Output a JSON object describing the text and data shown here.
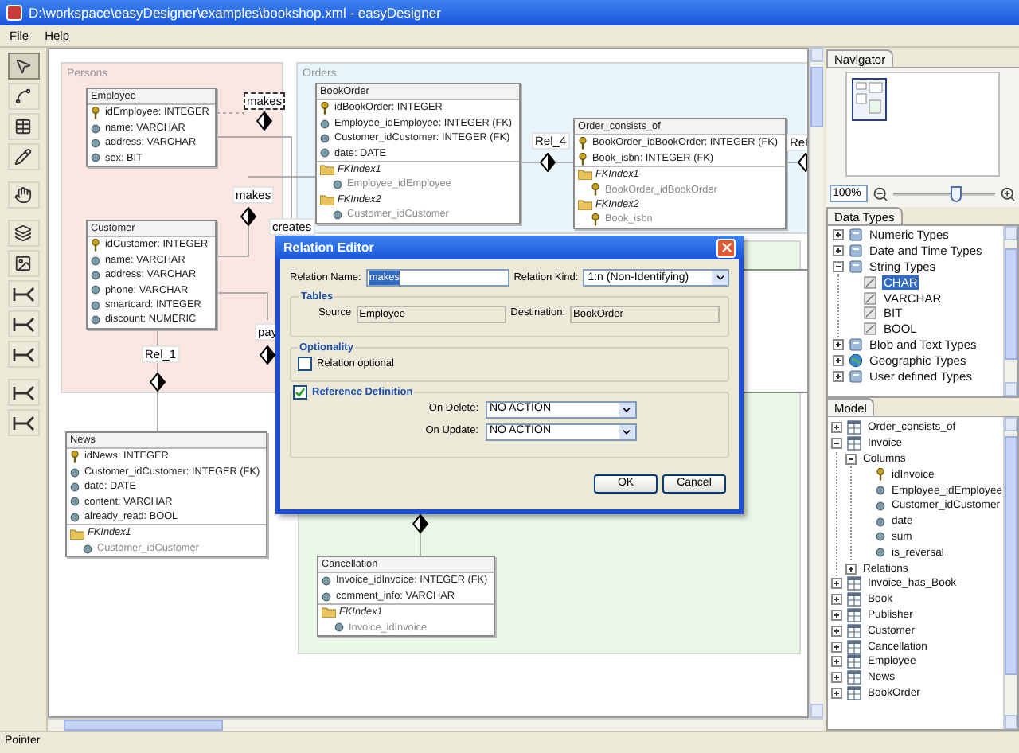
{
  "window": {
    "title": "D:\\workspace\\easyDesigner\\examples\\bookshop.xml - easyDesigner"
  },
  "menu": [
    "File",
    "Help"
  ],
  "tools": [
    {
      "kind": "pointer",
      "selected": true
    },
    {
      "kind": "connect",
      "selected": false
    },
    {
      "kind": "table",
      "selected": false
    },
    {
      "kind": "pencil",
      "selected": false
    },
    {
      "kind": "hand",
      "selected": false
    },
    {
      "kind": "group",
      "selected": false
    },
    {
      "kind": "image",
      "selected": false
    },
    {
      "kind": "relation",
      "selected": false
    },
    {
      "kind": "relation",
      "selected": false
    },
    {
      "kind": "relation",
      "selected": false
    },
    {
      "kind": "relation",
      "selected": false
    },
    {
      "kind": "relation",
      "selected": false
    }
  ],
  "diagram": {
    "groups": [
      {
        "label": "Persons",
        "color": "#fbe6e4"
      },
      {
        "label": "Orders",
        "color": "#e8f5fb"
      },
      {
        "color": "#e9f8e6"
      }
    ],
    "tables": [
      {
        "name": "Employee",
        "columns": [
          {
            "text": "idEmployee: INTEGER",
            "kind": "key"
          },
          {
            "text": "name: VARCHAR",
            "kind": "column"
          },
          {
            "text": "address: VARCHAR",
            "kind": "column"
          },
          {
            "text": "sex: BIT",
            "kind": "column"
          }
        ]
      },
      {
        "name": "Customer",
        "columns": [
          {
            "text": "idCustomer: INTEGER",
            "kind": "key"
          },
          {
            "text": "name: VARCHAR",
            "kind": "column"
          },
          {
            "text": "address: VARCHAR",
            "kind": "column"
          },
          {
            "text": "phone: VARCHAR",
            "kind": "column"
          },
          {
            "text": "smartcard: INTEGER",
            "kind": "column"
          },
          {
            "text": "discount: NUMERIC",
            "kind": "column"
          }
        ]
      },
      {
        "name": "BookOrder",
        "columns": [
          {
            "text": "idBookOrder: INTEGER",
            "kind": "key"
          },
          {
            "text": "Employee_idEmployee: INTEGER (FK)",
            "kind": "column"
          },
          {
            "text": "Customer_idCustomer: INTEGER (FK)",
            "kind": "column"
          },
          {
            "text": "date: DATE",
            "kind": "column"
          }
        ],
        "indexes": [
          {
            "name": "FKIndex1",
            "columns": [
              {
                "text": "Employee_idEmployee",
                "kind": "column"
              }
            ]
          },
          {
            "name": "FKIndex2",
            "columns": [
              {
                "text": "Customer_idCustomer",
                "kind": "column"
              }
            ]
          }
        ]
      },
      {
        "name": "Order_consists_of",
        "columns": [
          {
            "text": "BookOrder_idBookOrder: INTEGER (FK)",
            "kind": "key"
          },
          {
            "text": "Book_isbn: INTEGER (FK)",
            "kind": "key"
          }
        ],
        "indexes": [
          {
            "name": "FKIndex1",
            "columns": [
              {
                "text": "BookOrder_idBookOrder",
                "kind": "key"
              }
            ]
          },
          {
            "name": "FKIndex2",
            "columns": [
              {
                "text": "Book_isbn",
                "kind": "key"
              }
            ]
          }
        ]
      },
      {
        "name": "News",
        "columns": [
          {
            "text": "idNews: INTEGER",
            "kind": "key"
          },
          {
            "text": "Customer_idCustomer: INTEGER (FK)",
            "kind": "column"
          },
          {
            "text": "date: DATE",
            "kind": "column"
          },
          {
            "text": "content: VARCHAR",
            "kind": "column"
          },
          {
            "text": "already_read: BOOL",
            "kind": "column"
          }
        ],
        "indexes": [
          {
            "name": "FKIndex1",
            "columns": [
              {
                "text": "Customer_idCustomer",
                "kind": "column"
              }
            ]
          }
        ]
      },
      {
        "name": "Cancellation",
        "columns": [
          {
            "text": "Invoice_idInvoice: INTEGER (FK)",
            "kind": "column"
          },
          {
            "text": "comment_info: VARCHAR",
            "kind": "column"
          }
        ],
        "indexes": [
          {
            "name": "FKIndex1",
            "columns": [
              {
                "text": "Invoice_idInvoice",
                "kind": "column"
              }
            ]
          }
        ]
      }
    ],
    "relations": [
      {
        "label": "makes",
        "selected": true
      },
      {
        "label": "makes",
        "selected": false
      },
      {
        "label": "creates",
        "selected": false
      },
      {
        "label": "Rel_1",
        "selected": false
      },
      {
        "label": "pay",
        "selected": false
      },
      {
        "label": "Rel_4",
        "selected": false
      },
      {
        "label": "Rel",
        "selected": false
      }
    ]
  },
  "dialog": {
    "title": "Relation Editor",
    "relation_name": {
      "label": "Relation Name:",
      "value": "makes"
    },
    "relation_kind": {
      "label": "Relation Kind:",
      "value": "1:n (Non-Identifying)"
    },
    "tables": {
      "title": "Tables",
      "source": {
        "label": "Source",
        "value": "Employee"
      },
      "destination": {
        "label": "Destination:",
        "value": "BookOrder"
      }
    },
    "optionality": {
      "title": "Optionality",
      "checkbox": {
        "label": "Relation optional",
        "checked": false
      }
    },
    "reference": {
      "label": "Reference Definition",
      "checked": true,
      "on_delete": {
        "label": "On Delete:",
        "value": "NO ACTION"
      },
      "on_update": {
        "label": "On Update:",
        "value": "NO ACTION"
      }
    },
    "buttons": [
      "OK",
      "Cancel"
    ]
  },
  "navigator": {
    "tab": "Navigator",
    "zoom": "100%",
    "level": 0.62
  },
  "data_types": {
    "tab": "Data Types",
    "tree": [
      {
        "label": "Numeric Types",
        "kind": "category",
        "expanded": false,
        "selected": false
      },
      {
        "label": "Date and Time Types",
        "kind": "category",
        "expanded": false,
        "selected": false
      },
      {
        "label": "String Types",
        "kind": "category",
        "expanded": true,
        "selected": false,
        "children": [
          {
            "label": "CHAR",
            "kind": "type",
            "selected": true
          },
          {
            "label": "VARCHAR",
            "kind": "type",
            "selected": false
          },
          {
            "label": "BIT",
            "kind": "type",
            "selected": false
          },
          {
            "label": "BOOL",
            "kind": "type",
            "selected": false
          }
        ]
      },
      {
        "label": "Blob and Text Types",
        "kind": "category",
        "expanded": false,
        "selected": false
      },
      {
        "label": "Geographic Types",
        "kind": "globe",
        "expanded": false,
        "selected": false
      },
      {
        "label": "User defined Types",
        "kind": "category",
        "expanded": false,
        "selected": false
      }
    ]
  },
  "model": {
    "tab": "Model",
    "tree": [
      {
        "label": "Order_consists_of",
        "kind": "table",
        "expanded": false,
        "selected": false
      },
      {
        "label": "Invoice",
        "kind": "table",
        "expanded": true,
        "selected": false,
        "children": [
          {
            "label": "Columns",
            "expanded": true,
            "selected": false,
            "children": [
              {
                "label": "idInvoice",
                "kind": "key",
                "selected": false
              },
              {
                "label": "Employee_idEmployee",
                "kind": "column",
                "selected": false
              },
              {
                "label": "Customer_idCustomer",
                "kind": "column",
                "selected": false
              },
              {
                "label": "date",
                "kind": "column",
                "selected": false
              },
              {
                "label": "sum",
                "kind": "column",
                "selected": false
              },
              {
                "label": "is_reversal",
                "kind": "column",
                "selected": false
              }
            ]
          },
          {
            "label": "Relations",
            "expanded": false,
            "selected": false
          }
        ]
      },
      {
        "label": "Invoice_has_Book",
        "kind": "table",
        "expanded": false,
        "selected": false
      },
      {
        "label": "Book",
        "kind": "table",
        "expanded": false,
        "selected": false
      },
      {
        "label": "Publisher",
        "kind": "table",
        "expanded": false,
        "selected": false
      },
      {
        "label": "Customer",
        "kind": "table",
        "expanded": false,
        "selected": false
      },
      {
        "label": "Cancellation",
        "kind": "table",
        "expanded": false,
        "selected": false
      },
      {
        "label": "Employee",
        "kind": "table",
        "expanded": false,
        "selected": false
      },
      {
        "label": "News",
        "kind": "table",
        "expanded": false,
        "selected": false
      },
      {
        "label": "BookOrder",
        "kind": "table",
        "expanded": false,
        "selected": false
      }
    ]
  },
  "status_bar": "Pointer"
}
